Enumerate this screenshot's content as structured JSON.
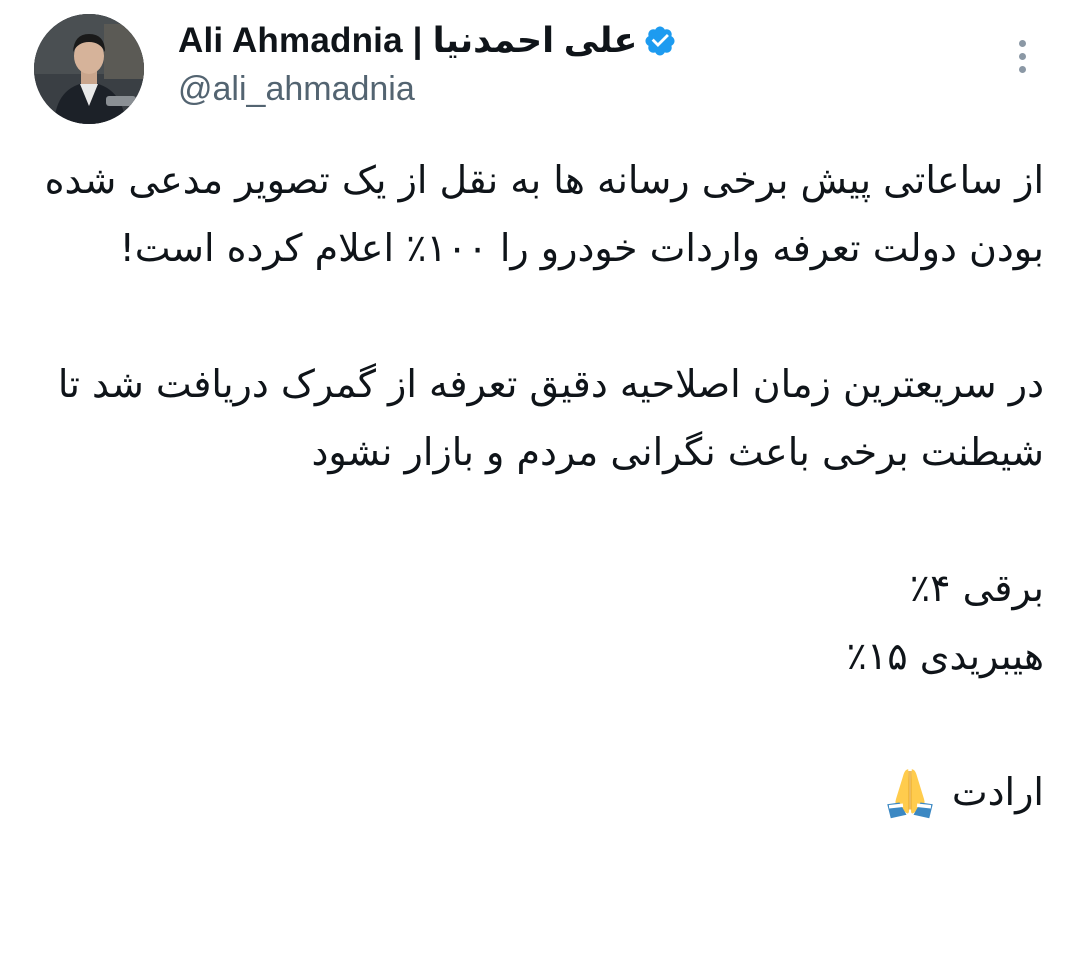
{
  "author": {
    "display_name": "Ali Ahmadnia | علی احمدنیا",
    "handle": "@ali_ahmadnia",
    "verified": true
  },
  "icons": {
    "verified": "verified-badge-icon",
    "more": "more-vertical-icon",
    "emoji": "folded-hands-emoji"
  },
  "colors": {
    "verified_blue": "#1d9bf0",
    "text": "#0f1419",
    "secondary": "#536471"
  },
  "tweet": {
    "paragraphs": [
      "از ساعاتی پیش برخی رسانه ها به نقل از یک تصویر مدعی شده بودن دولت تعرفه واردات خودرو را ۱۰۰٪ اعلام کرده است!",
      "در سریعترین زمان اصلاحیه دقیق تعرفه از گمرک دریافت شد تا شیطنت برخی باعث نگرانی مردم و بازار نشود",
      "برقی ۴٪",
      "هیبریدی ۱۵٪",
      "ارادت"
    ]
  }
}
